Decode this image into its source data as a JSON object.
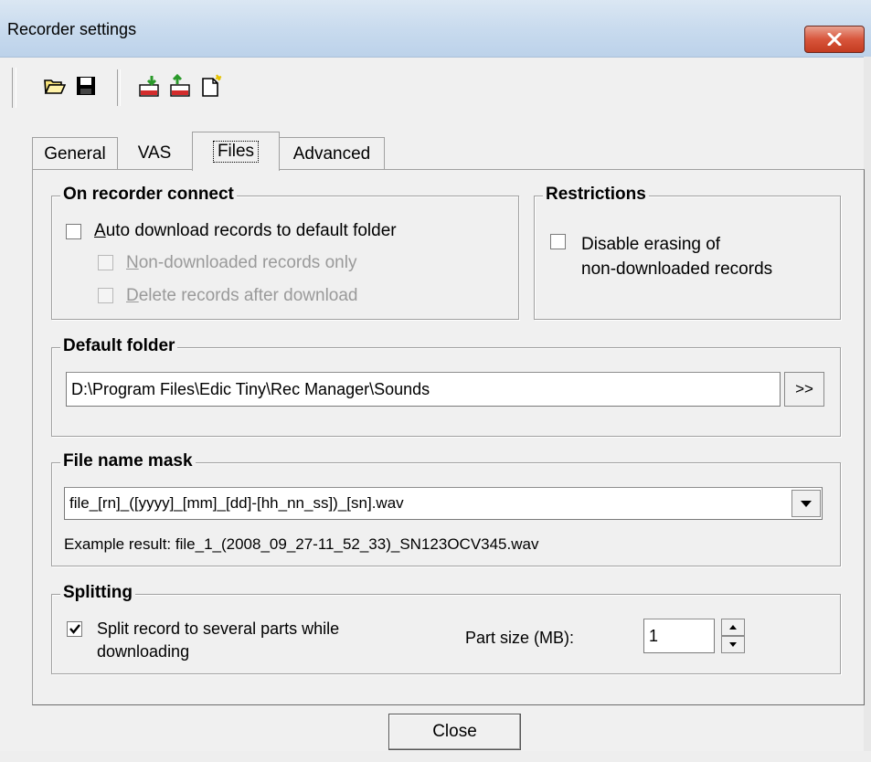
{
  "window": {
    "title": "Recorder settings"
  },
  "toolbar": {
    "buttons": [
      {
        "icon": "open-folder-icon"
      },
      {
        "icon": "save-disk-icon"
      },
      {
        "icon": "download-to-device-icon"
      },
      {
        "icon": "upload-from-device-icon"
      },
      {
        "icon": "new-document-icon"
      }
    ]
  },
  "tabs": [
    "General",
    "VAS",
    "Files",
    "Advanced"
  ],
  "active_tab": "Files",
  "on_connect": {
    "title": "On recorder connect",
    "auto_download": {
      "underline": "A",
      "rest": "uto download records to default folder",
      "checked": false
    },
    "non_downloaded": {
      "underline": "N",
      "rest": "on-downloaded records only",
      "checked": false,
      "disabled": true
    },
    "delete_after": {
      "underline": "D",
      "rest": "elete records after download",
      "checked": false,
      "disabled": true
    }
  },
  "restrictions": {
    "title": "Restrictions",
    "disable_erasing_line1": "Disable erasing of",
    "disable_erasing_line2": "non-downloaded records",
    "checked": false
  },
  "default_folder": {
    "title": "Default folder",
    "path": "D:\\Program Files\\Edic Tiny\\Rec Manager\\Sounds",
    "browse_label": ">>"
  },
  "file_mask": {
    "title": "File name mask",
    "value": "file_[rn]_([yyyy]_[mm]_[dd]-[hh_nn_ss])_[sn].wav",
    "example": "Example result: file_1_(2008_09_27-11_52_33)_SN123OCV345.wav"
  },
  "splitting": {
    "title": "Splitting",
    "split_line1": "Split record to several parts while",
    "split_line2": "downloading",
    "checked": true,
    "part_size_label": "Part size (MB):",
    "part_size_value": "1"
  },
  "footer": {
    "close_label": "Close"
  }
}
